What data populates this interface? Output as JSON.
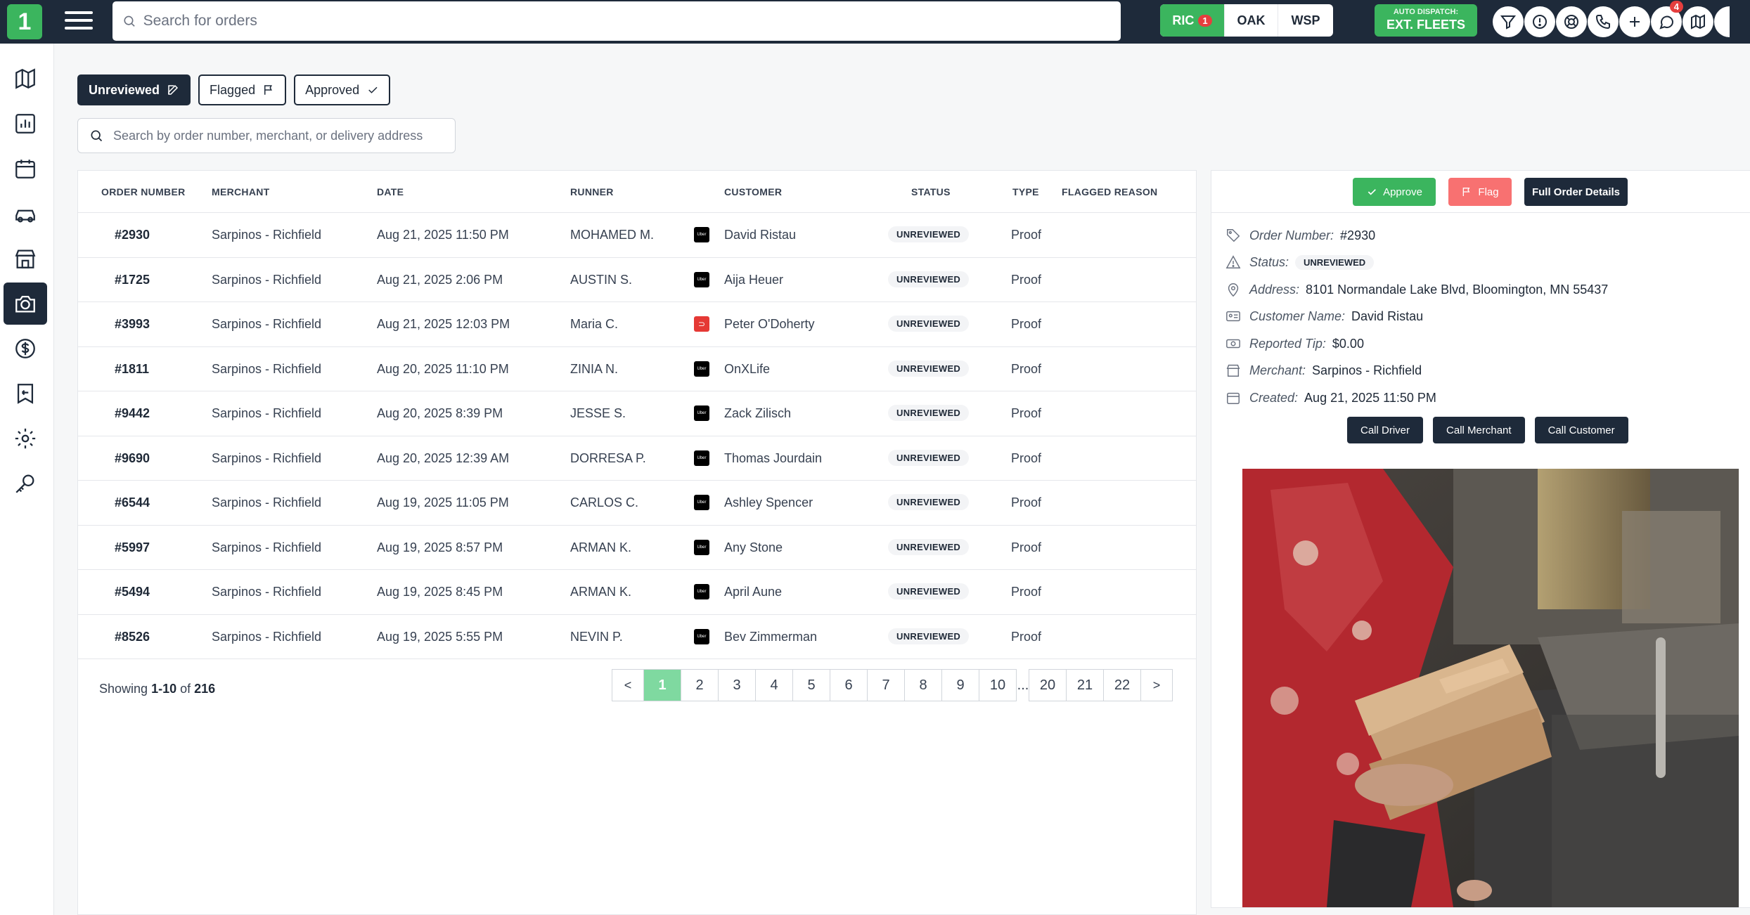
{
  "topbar": {
    "logo_text": "1",
    "search_placeholder": "Search for orders",
    "markets": [
      {
        "code": "RIC",
        "badge": "1",
        "active": true
      },
      {
        "code": "OAK",
        "badge": "",
        "active": false
      },
      {
        "code": "WSP",
        "badge": "",
        "active": false
      }
    ],
    "auto_dispatch_label": "AUTO DISPATCH:",
    "auto_dispatch_value": "EXT. FLEETS",
    "chat_badge": "4"
  },
  "filters": {
    "unreviewed": "Unreviewed",
    "flagged": "Flagged",
    "approved": "Approved"
  },
  "order_search_placeholder": "Search by order number, merchant, or delivery address",
  "table": {
    "headers": {
      "order_number": "ORDER NUMBER",
      "merchant": "MERCHANT",
      "date": "DATE",
      "runner": "RUNNER",
      "customer": "CUSTOMER",
      "status": "STATUS",
      "type": "TYPE",
      "flagged_reason": "FLAGGED REASON"
    },
    "rows": [
      {
        "order": "#2930",
        "merchant": "Sarpinos - Richfield",
        "date": "Aug 21, 2025 11:50 PM",
        "runner": "MOHAMED M.",
        "platform": "Uber",
        "customer": "David Ristau",
        "status": "UNREVIEWED",
        "type": "Proof"
      },
      {
        "order": "#1725",
        "merchant": "Sarpinos - Richfield",
        "date": "Aug 21, 2025 2:06 PM",
        "runner": "AUSTIN S.",
        "platform": "Uber",
        "customer": "Aija Heuer",
        "status": "UNREVIEWED",
        "type": "Proof"
      },
      {
        "order": "#3993",
        "merchant": "Sarpinos - Richfield",
        "date": "Aug 21, 2025 12:03 PM",
        "runner": "Maria C.",
        "platform": "DoorDash",
        "customer": "Peter O'Doherty",
        "status": "UNREVIEWED",
        "type": "Proof"
      },
      {
        "order": "#1811",
        "merchant": "Sarpinos - Richfield",
        "date": "Aug 20, 2025 11:10 PM",
        "runner": "ZINIA N.",
        "platform": "Uber",
        "customer": "OnXLife",
        "status": "UNREVIEWED",
        "type": "Proof"
      },
      {
        "order": "#9442",
        "merchant": "Sarpinos - Richfield",
        "date": "Aug 20, 2025 8:39 PM",
        "runner": "JESSE S.",
        "platform": "Uber",
        "customer": "Zack Zilisch",
        "status": "UNREVIEWED",
        "type": "Proof"
      },
      {
        "order": "#9690",
        "merchant": "Sarpinos - Richfield",
        "date": "Aug 20, 2025 12:39 AM",
        "runner": "DORRESA P.",
        "platform": "Uber",
        "customer": "Thomas Jourdain",
        "status": "UNREVIEWED",
        "type": "Proof"
      },
      {
        "order": "#6544",
        "merchant": "Sarpinos - Richfield",
        "date": "Aug 19, 2025 11:05 PM",
        "runner": "CARLOS C.",
        "platform": "Uber",
        "customer": "Ashley Spencer",
        "status": "UNREVIEWED",
        "type": "Proof"
      },
      {
        "order": "#5997",
        "merchant": "Sarpinos - Richfield",
        "date": "Aug 19, 2025 8:57 PM",
        "runner": "ARMAN K.",
        "platform": "Uber",
        "customer": "Any Stone",
        "status": "UNREVIEWED",
        "type": "Proof"
      },
      {
        "order": "#5494",
        "merchant": "Sarpinos - Richfield",
        "date": "Aug 19, 2025 8:45 PM",
        "runner": "ARMAN K.",
        "platform": "Uber",
        "customer": "April Aune",
        "status": "UNREVIEWED",
        "type": "Proof"
      },
      {
        "order": "#8526",
        "merchant": "Sarpinos - Richfield",
        "date": "Aug 19, 2025 5:55 PM",
        "runner": "NEVIN P.",
        "platform": "Uber",
        "customer": "Bev Zimmerman",
        "status": "UNREVIEWED",
        "type": "Proof"
      }
    ]
  },
  "pagination": {
    "showing_prefix": "Showing",
    "showing_range": "1-10",
    "showing_of": "of",
    "showing_total": "216",
    "prev": "<",
    "next": ">",
    "pages": [
      "1",
      "2",
      "3",
      "4",
      "5",
      "6",
      "7",
      "8",
      "9",
      "10"
    ],
    "ellipsis": "...",
    "tail_pages": [
      "20",
      "21",
      "22"
    ],
    "current": "1"
  },
  "detail": {
    "approve_label": "Approve",
    "flag_label": "Flag",
    "full_details_label": "Full Order Details",
    "order_number_label": "Order Number:",
    "order_number": "#2930",
    "status_label": "Status:",
    "status": "UNREVIEWED",
    "address_label": "Address:",
    "address": "8101 Normandale Lake Blvd, Bloomington, MN 55437",
    "customer_label": "Customer Name:",
    "customer": "David Ristau",
    "tip_label": "Reported Tip:",
    "tip": "$0.00",
    "merchant_label": "Merchant:",
    "merchant": "Sarpinos - Richfield",
    "created_label": "Created:",
    "created": "Aug 21, 2025 11:50 PM",
    "call_driver": "Call Driver",
    "call_merchant": "Call Merchant",
    "call_customer": "Call Customer"
  },
  "colors": {
    "navy": "#1e2a3a",
    "green": "#3bb55e",
    "red": "#f87171",
    "pager_active": "#7fd9a0"
  }
}
